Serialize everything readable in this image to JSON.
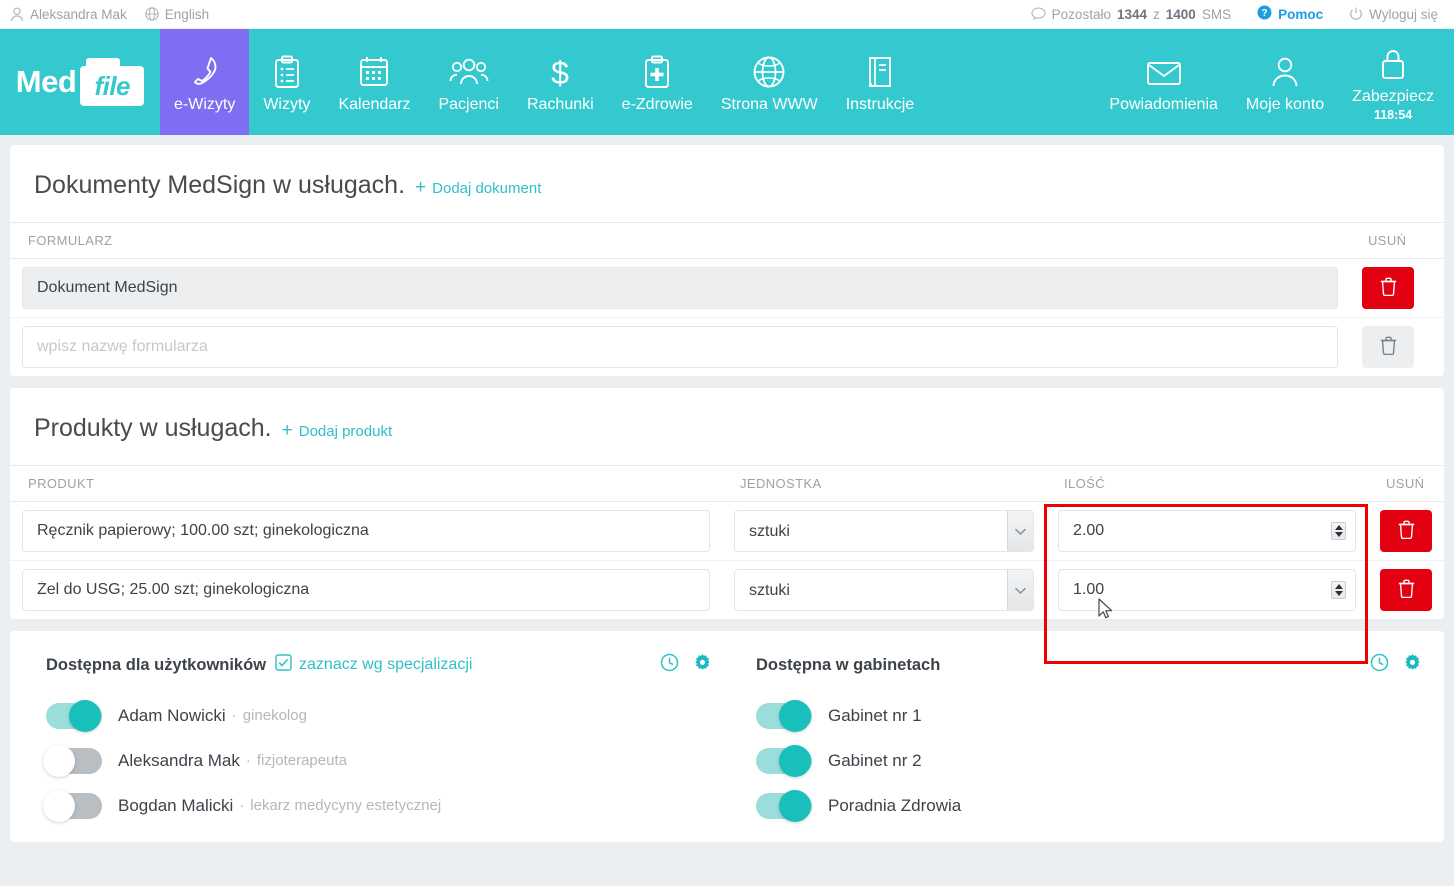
{
  "topbar": {
    "user": "Aleksandra Mak",
    "user_icon": "user-icon",
    "language": "English",
    "language_icon": "globe-icon",
    "sms_prefix": "Pozostało",
    "sms_used": "1344",
    "sms_mid": "z",
    "sms_total": "1400",
    "sms_suffix": "SMS",
    "sms_icon": "chat-bubble-icon",
    "help": "Pomoc",
    "help_icon": "question-circle-icon",
    "logout": "Wyloguj się",
    "logout_icon": "power-icon"
  },
  "nav": {
    "logo_med": "Med",
    "logo_file": "file",
    "active_item": "e-Wizyty",
    "items": [
      {
        "label": "e-Wizyty",
        "icon": "phone-icon",
        "active": true
      },
      {
        "label": "Wizyty",
        "icon": "clipboard-list-icon",
        "active": false
      },
      {
        "label": "Kalendarz",
        "icon": "calendar-icon",
        "active": false
      },
      {
        "label": "Pacjenci",
        "icon": "people-group-icon",
        "active": false
      },
      {
        "label": "Rachunki",
        "icon": "dollar-icon",
        "active": false
      },
      {
        "label": "e-Zdrowie",
        "icon": "clipboard-medical-icon",
        "active": false
      },
      {
        "label": "Strona WWW",
        "icon": "globe-icon",
        "active": false
      },
      {
        "label": "Instrukcje",
        "icon": "book-icon",
        "active": false
      }
    ],
    "right_items": [
      {
        "label": "Powiadomienia",
        "icon": "envelope-icon",
        "sub": ""
      },
      {
        "label": "Moje konto",
        "icon": "user-icon",
        "sub": ""
      },
      {
        "label": "Zabezpiecz",
        "icon": "lock-icon",
        "sub": "118:54"
      }
    ]
  },
  "documents_panel": {
    "title": "Dokumenty MedSign w usługach.",
    "add_label": "Dodaj dokument",
    "add_plus": "+",
    "columns": {
      "form": "FORMULARZ",
      "delete": "USUŃ"
    },
    "rows": [
      {
        "value": "Dokument MedSign",
        "placeholder": "",
        "filled": true,
        "delete_active": true
      },
      {
        "value": "",
        "placeholder": "wpisz nazwę formularza",
        "filled": false,
        "delete_active": false
      }
    ]
  },
  "products_panel": {
    "title": "Produkty w usługach.",
    "add_label": "Dodaj produkt",
    "add_plus": "+",
    "columns": {
      "product": "PRODUKT",
      "unit": "JEDNOSTKA",
      "quantity": "ILOŚĆ",
      "delete": "USUŃ"
    },
    "highlight_color": "#f00000",
    "rows": [
      {
        "product": "Ręcznik papierowy; 100.00 szt; ginekologiczna",
        "unit": "sztuki",
        "quantity": "2.00"
      },
      {
        "product": "Żel do USG; 25.00 szt; ginekologiczna",
        "unit": "sztuki",
        "quantity": "1.00"
      }
    ],
    "unit_options": [
      "sztuki"
    ]
  },
  "availability": {
    "users": {
      "title": "Dostępna dla użytkowników",
      "spec_link": "zaznacz wg specjalizacji",
      "checkbox_icon": "checkbox-checked-icon",
      "clock_icon": "clock-icon",
      "gear_icon": "gear-icon",
      "rows": [
        {
          "name": "Adam Nowicki",
          "sep": "·",
          "spec": "ginekolog",
          "on": true
        },
        {
          "name": "Aleksandra Mak",
          "sep": "·",
          "spec": "fizjoterapeuta",
          "on": false
        },
        {
          "name": "Bogdan Malicki",
          "sep": "·",
          "spec": "lekarz medycyny estetycznej",
          "on": false
        }
      ]
    },
    "rooms": {
      "title": "Dostępna w gabinetach",
      "clock_icon": "clock-icon",
      "gear_icon": "gear-icon",
      "rows": [
        {
          "name": "Gabinet nr 1",
          "on": true
        },
        {
          "name": "Gabinet nr 2",
          "on": true
        },
        {
          "name": "Poradnia Zdrowia",
          "on": true
        }
      ]
    }
  },
  "colors": {
    "brand_teal": "#33c9cf",
    "accent_purple": "#7f6df2",
    "link_teal": "#2fc0c8",
    "danger_red": "#e30011",
    "highlight_red": "#f00000",
    "help_blue": "#199fe0"
  }
}
